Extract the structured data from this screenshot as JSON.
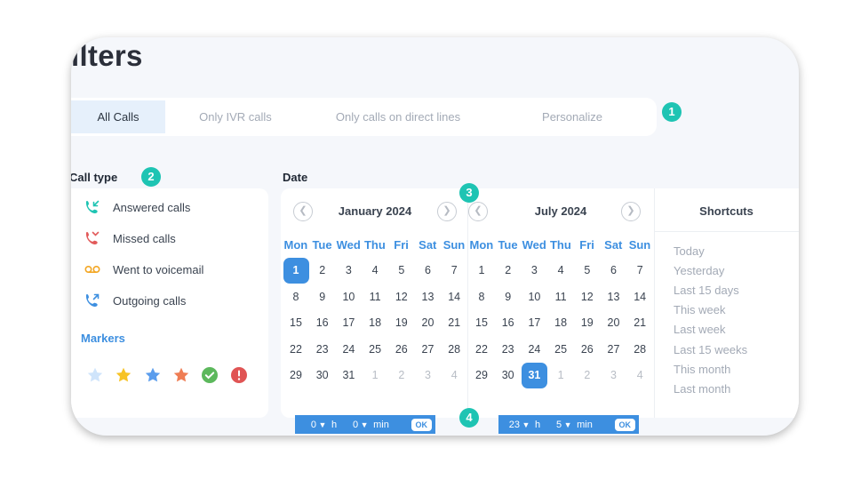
{
  "page": {
    "title": "ilters"
  },
  "tabs": [
    {
      "label": "All Calls",
      "active": true
    },
    {
      "label": "Only IVR calls",
      "active": false
    },
    {
      "label": "Only calls on direct lines",
      "active": false
    },
    {
      "label": "Personalize",
      "active": false
    }
  ],
  "badges": [
    "1",
    "2",
    "3",
    "4"
  ],
  "call_type": {
    "title": "Call type",
    "items": [
      {
        "label": "Answered calls",
        "icon": "answered-call-icon",
        "color": "#1ec4b3"
      },
      {
        "label": "Missed calls",
        "icon": "missed-call-icon",
        "color": "#e25a5a"
      },
      {
        "label": "Went to voicemail",
        "icon": "voicemail-icon",
        "color": "#f3a623"
      },
      {
        "label": "Outgoing calls",
        "icon": "outgoing-call-icon",
        "color": "#3d8fe0"
      }
    ],
    "markers_title": "Markers",
    "markers": [
      {
        "icon": "star-icon",
        "color": "#cfe4fb"
      },
      {
        "icon": "star-icon",
        "color": "#f7c325"
      },
      {
        "icon": "star-icon",
        "color": "#5b9ded"
      },
      {
        "icon": "star-icon",
        "color": "#ef7d54"
      },
      {
        "icon": "check-circle-icon",
        "color": "#5cb85c"
      },
      {
        "icon": "exclamation-circle-icon",
        "color": "#e05454"
      }
    ]
  },
  "date": {
    "title": "Date",
    "weekdays": [
      "Mon",
      "Tue",
      "Wed",
      "Thu",
      "Fri",
      "Sat",
      "Sun"
    ],
    "months": [
      {
        "name": "January 2024",
        "selected": "1",
        "weeks": [
          [
            "1",
            "2",
            "3",
            "4",
            "5",
            "6",
            "7"
          ],
          [
            "8",
            "9",
            "10",
            "11",
            "12",
            "13",
            "14"
          ],
          [
            "15",
            "16",
            "17",
            "18",
            "19",
            "20",
            "21"
          ],
          [
            "22",
            "23",
            "24",
            "25",
            "26",
            "27",
            "28"
          ],
          [
            "29",
            "30",
            "31",
            "1",
            "2",
            "3",
            "4"
          ]
        ],
        "trailing_other_from": 3
      },
      {
        "name": "July 2024",
        "selected": "31",
        "weeks": [
          [
            "1",
            "2",
            "3",
            "4",
            "5",
            "6",
            "7"
          ],
          [
            "8",
            "9",
            "10",
            "11",
            "12",
            "13",
            "14"
          ],
          [
            "15",
            "16",
            "17",
            "18",
            "19",
            "20",
            "21"
          ],
          [
            "22",
            "23",
            "24",
            "25",
            "26",
            "27",
            "28"
          ],
          [
            "29",
            "30",
            "31",
            "1",
            "2",
            "3",
            "4"
          ]
        ],
        "trailing_other_from": 3
      }
    ],
    "shortcuts_title": "Shortcuts",
    "shortcuts": [
      "Today",
      "Yesterday",
      "Last 15 days",
      "This week",
      "Last week",
      "Last 15 weeks",
      "This month",
      "Last month"
    ]
  },
  "time_pickers": [
    {
      "hours": "0",
      "h_label": "h",
      "minutes": "0",
      "min_label": "min",
      "ok": "OK"
    },
    {
      "hours": "23",
      "h_label": "h",
      "minutes": "5",
      "min_label": "min",
      "ok": "OK"
    }
  ]
}
